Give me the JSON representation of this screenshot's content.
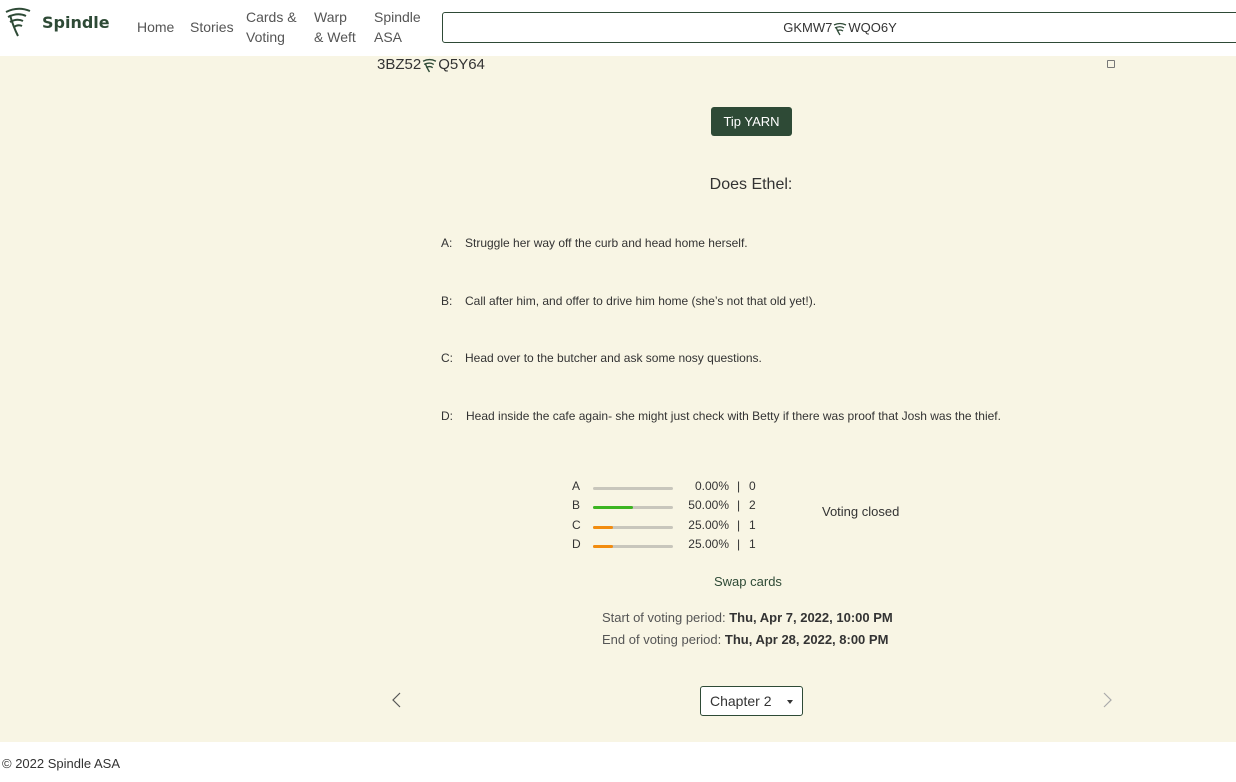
{
  "header": {
    "brand": "Spindle",
    "nav": [
      {
        "line1": "Home",
        "line2": ""
      },
      {
        "line1": "Stories",
        "line2": ""
      },
      {
        "line1": "Cards &",
        "line2": "Voting"
      },
      {
        "line1": "Warp",
        "line2": "& Weft"
      },
      {
        "line1": "Spindle",
        "line2": "ASA"
      }
    ],
    "wallet": {
      "part1": "GKMW7",
      "part2": "WQO6Y"
    }
  },
  "card": {
    "id_part1": "3BZ52",
    "id_part2": "Q5Y64",
    "tip_label": "Tip YARN",
    "question": "Does Ethel:",
    "options": [
      {
        "letter": "A:",
        "text": "Struggle her way off the curb and head home herself."
      },
      {
        "letter": "B:",
        "text": "Call after him, and offer to drive him home (she’s not that old yet!)."
      },
      {
        "letter": "C:",
        "text": "Head over to the butcher and ask some nosy questions."
      },
      {
        "letter": "D:",
        "text": "Head inside the cafe again- she might just check with Betty if there was proof that Josh was the thief."
      }
    ]
  },
  "results": {
    "rows": [
      {
        "label": "A",
        "fraction": 0.0,
        "percent": "0.00%",
        "sep": "|",
        "count": "0",
        "color": "#c8c6bc"
      },
      {
        "label": "B",
        "fraction": 0.5,
        "percent": "50.00%",
        "sep": "|",
        "count": "2",
        "color": "#3cb521"
      },
      {
        "label": "C",
        "fraction": 0.25,
        "percent": "25.00%",
        "sep": "|",
        "count": "1",
        "color": "#f28c0f"
      },
      {
        "label": "D",
        "fraction": 0.25,
        "percent": "25.00%",
        "sep": "|",
        "count": "1",
        "color": "#f28c0f"
      }
    ],
    "status": "Voting closed",
    "swap_label": "Swap cards",
    "start_label": "Start of voting period:",
    "start_value": "Thu, Apr 7, 2022, 10:00 PM",
    "end_label": "End of voting period:",
    "end_value": "Thu, Apr 28, 2022, 8:00 PM"
  },
  "pager": {
    "prev_icon": "chevron-left-icon",
    "next_icon": "chevron-right-icon",
    "chapter": "Chapter 2"
  },
  "footer": {
    "text": "© 2022 Spindle ASA"
  },
  "colors": {
    "brand": "#2e4a36",
    "background": "#f8f5e4"
  }
}
